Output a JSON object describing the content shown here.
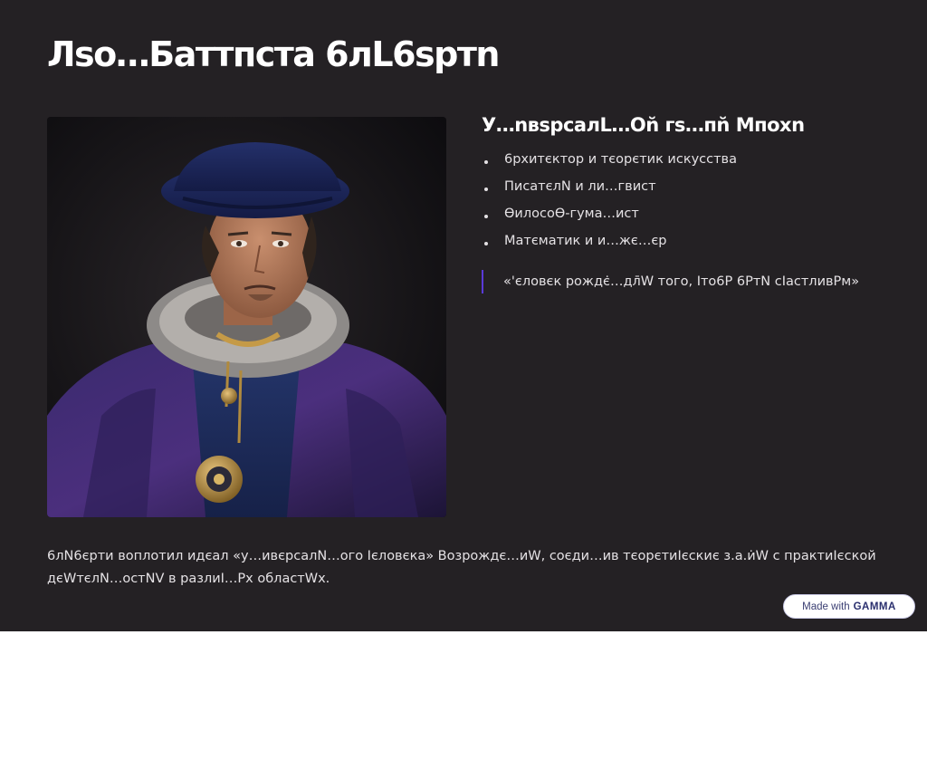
{
  "slide": {
    "title": "Лsо…Баттпста 6лL6sртn",
    "subtitle": "У…nвsрсалL…Оn̆ гs…пn̆ Мпохn",
    "bullets": [
      "6рхитєктор и тєорєтик искусства",
      "ПисатєлN и ли…гвист",
      "ӨилосоӨ-гума…ист",
      "Матєматик и и…жє…єр"
    ],
    "quote": "«'єловєк рождє̇…дл̄W того, Iто6Р 6РтN сIастливРм»",
    "bottom_text": "6лN6єрти воплотил идєал «у…ивєрсалN…ого Iєловєка» Возрождє…иW, соєди…ив тєорєтиIєскиє з.а.и̇W с практиIєской дєWтєлN…остNV в разлиI…Рх областWх."
  },
  "badge": {
    "prefix": "Made with",
    "brand": "GAMMA"
  },
  "colors": {
    "background": "#242124",
    "accent": "#5a3ad8",
    "text": "#e4e1e4",
    "page": "#ffffff"
  },
  "icons": {
    "bullet": "bullet-dot-icon",
    "portrait": "renaissance-portrait-image"
  }
}
